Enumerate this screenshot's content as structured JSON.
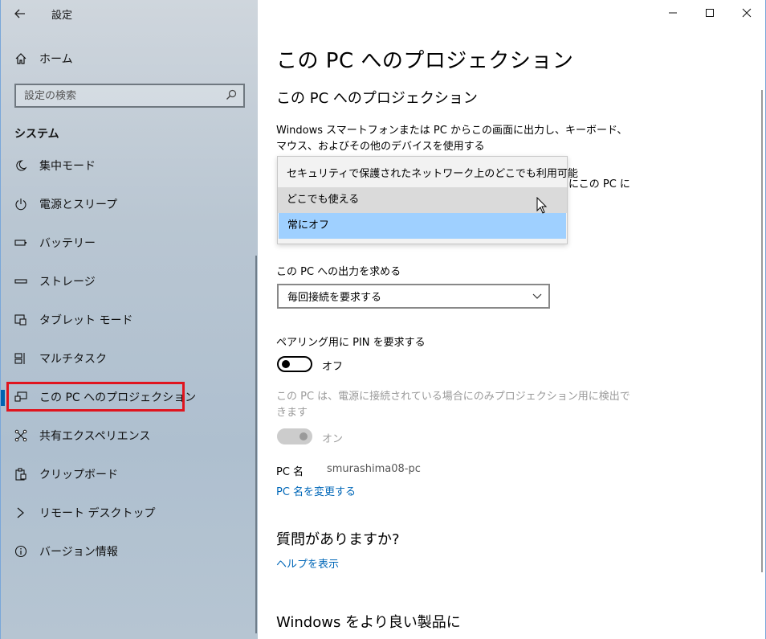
{
  "window": {
    "title": "設定",
    "controls": [
      "minimize",
      "maximize",
      "close"
    ]
  },
  "sidebar": {
    "home_label": "ホーム",
    "search_placeholder": "設定の検索",
    "section_title": "システム",
    "items": [
      {
        "label": "集中モード",
        "icon": "moon-icon"
      },
      {
        "label": "電源とスリープ",
        "icon": "power-icon"
      },
      {
        "label": "バッテリー",
        "icon": "battery-icon"
      },
      {
        "label": "ストレージ",
        "icon": "storage-icon"
      },
      {
        "label": "タブレット モード",
        "icon": "tablet-mode-icon"
      },
      {
        "label": "マルチタスク",
        "icon": "multitask-icon"
      },
      {
        "label": "この PC へのプロジェクション",
        "icon": "projection-icon",
        "active": true
      },
      {
        "label": "共有エクスペリエンス",
        "icon": "shared-experience-icon"
      },
      {
        "label": "クリップボード",
        "icon": "clipboard-icon"
      },
      {
        "label": "リモート デスクトップ",
        "icon": "remote-desktop-icon"
      },
      {
        "label": "バージョン情報",
        "icon": "info-icon"
      }
    ]
  },
  "main": {
    "page_title": "この PC へのプロジェクション",
    "section_heading": "この PC へのプロジェクション",
    "description": "Windows スマートフォンまたは PC からこの画面に出力し、キーボード、マウス、およびその他のデバイスを使用する",
    "description_clipped": "にこの PC に",
    "dropdown_open": {
      "options": [
        "セキュリティで保護されたネットワーク上のどこでも利用可能",
        "どこでも使える",
        "常にオフ"
      ],
      "hovered_index": 1,
      "selected_index": 2
    },
    "ask_label": "この PC への出力を求める",
    "ask_value": "毎回接続を要求する",
    "pin_label": "ペアリング用に PIN を要求する",
    "pin_toggle_state": "オフ",
    "power_label": "この PC は、電源に接続されている場合にのみプロジェクション用に検出できます",
    "power_toggle_state": "オン",
    "pc_name_label": "PC 名",
    "pc_name_value": "smurashima08-pc",
    "rename_link": "PC 名を変更する",
    "question_heading": "質問がありますか?",
    "help_link": "ヘルプを表示",
    "feedback_heading": "Windows をより良い製品に"
  },
  "colors": {
    "accent": "#0063b1",
    "link": "#0067b8",
    "highlight_border": "#e0141e",
    "selected_option": "#9fd0ff"
  }
}
